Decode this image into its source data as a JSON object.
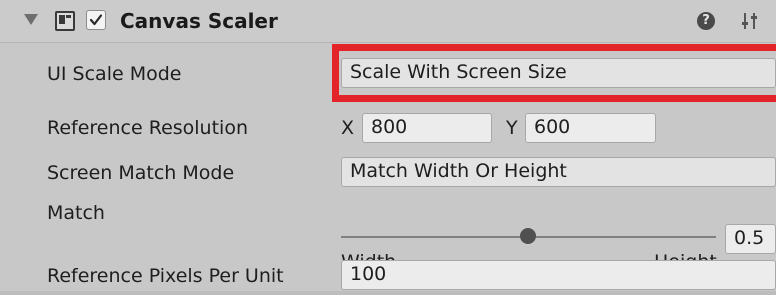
{
  "component": {
    "title": "Canvas Scaler",
    "enabled": true,
    "icons": {
      "foldout": "triangle-down-icon",
      "component": "canvas-scaler-icon",
      "help": "help-icon",
      "presets": "presets-icon"
    },
    "help_glyph": "?"
  },
  "fields": {
    "ui_scale_mode": {
      "label": "UI Scale Mode",
      "value": "Scale With Screen Size"
    },
    "reference_resolution": {
      "label": "Reference Resolution",
      "x_label": "X",
      "x_value": "800",
      "y_label": "Y",
      "y_value": "600"
    },
    "screen_match_mode": {
      "label": "Screen Match Mode",
      "value": "Match Width Or Height"
    },
    "match": {
      "label": "Match",
      "value": "0.5",
      "min_caption": "Width",
      "max_caption": "Height"
    },
    "reference_pixels_per_unit": {
      "label": "Reference Pixels Per Unit",
      "value": "100"
    }
  },
  "colors": {
    "highlight": "#e3242b",
    "panel_bg": "#c8c8c8"
  }
}
